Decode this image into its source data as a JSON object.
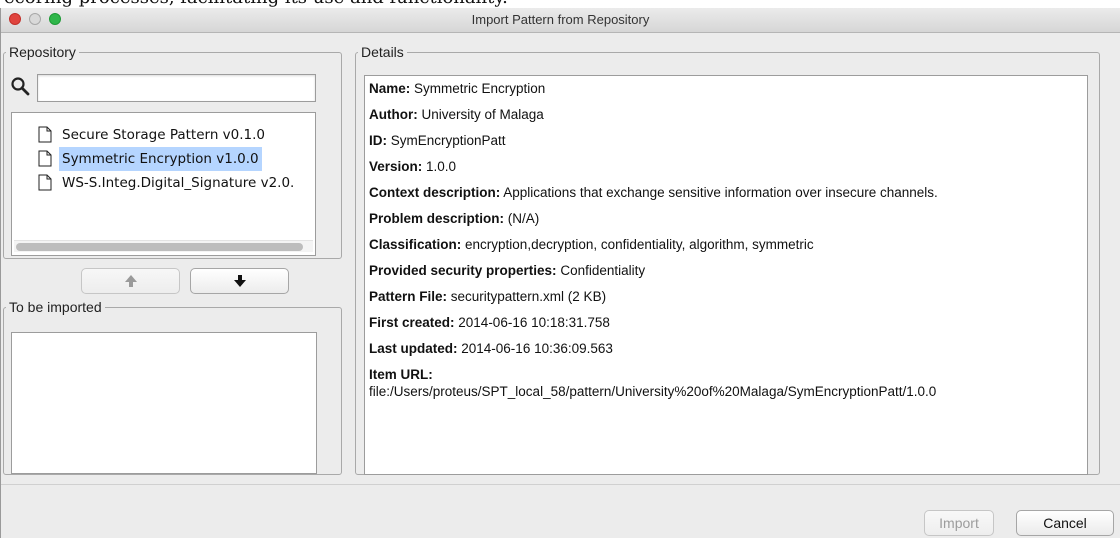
{
  "caption": "ecoring processes, facilitating its use and functionality.",
  "window": {
    "title": "Import Pattern from Repository"
  },
  "repository": {
    "legend": "Repository",
    "search": {
      "value": "",
      "placeholder": ""
    },
    "items": [
      {
        "label": "Secure Storage Pattern v0.1.0",
        "selected": false
      },
      {
        "label": "Symmetric Encryption v1.0.0",
        "selected": true
      },
      {
        "label": "WS-S.Integ.Digital_Signature v2.0.",
        "selected": false
      }
    ]
  },
  "to_be_imported": {
    "legend": "To be imported",
    "items": []
  },
  "details": {
    "legend": "Details",
    "fields": [
      {
        "label": "Name:",
        "value": " Symmetric Encryption"
      },
      {
        "label": "Author:",
        "value": " University of Malaga"
      },
      {
        "label": "ID:",
        "value": " SymEncryptionPatt"
      },
      {
        "label": "Version:",
        "value": " 1.0.0"
      },
      {
        "label": "Context description:",
        "value": " Applications that exchange sensitive information over insecure channels."
      },
      {
        "label": "Problem description:",
        "value": " (N/A)"
      },
      {
        "label": "Classification:",
        "value": " encryption,decryption, confidentiality, algorithm, symmetric"
      },
      {
        "label": "Provided security properties:",
        "value": " Confidentiality"
      },
      {
        "label": "Pattern File:",
        "value": " securitypattern.xml (2 KB)"
      },
      {
        "label": "First created:",
        "value": " 2014-06-16 10:18:31.758"
      },
      {
        "label": "Last updated:",
        "value": " 2014-06-16 10:36:09.563"
      },
      {
        "label": "Item URL:",
        "value": "file:/Users/proteus/SPT_local_58/pattern/University%20of%20Malaga/SymEncryptionPatt/1.0.0"
      }
    ]
  },
  "buttons": {
    "import": "Import",
    "cancel": "Cancel"
  },
  "colors": {
    "selection": "#b5d5ff",
    "close": "#e0443e",
    "maximize": "#2fb64a"
  }
}
